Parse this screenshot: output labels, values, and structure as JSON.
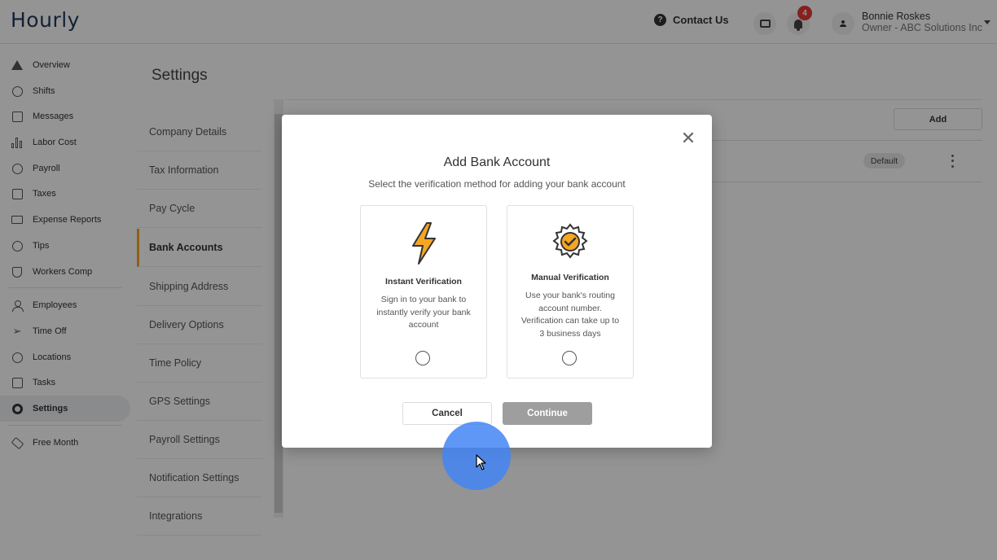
{
  "app": {
    "logo": "Hourly"
  },
  "header": {
    "contact_label": "Contact Us",
    "notification_count": "4",
    "user_name": "Bonnie Roskes",
    "user_role": "Owner - ABC Solutions Inc"
  },
  "sidebar": {
    "items": [
      {
        "label": "Overview",
        "icon": "home-icon"
      },
      {
        "label": "Shifts",
        "icon": "clock-icon"
      },
      {
        "label": "Messages",
        "icon": "messages-icon"
      },
      {
        "label": "Labor Cost",
        "icon": "bar-chart-icon"
      },
      {
        "label": "Payroll",
        "icon": "dollar-icon"
      },
      {
        "label": "Taxes",
        "icon": "document-icon"
      },
      {
        "label": "Expense Reports",
        "icon": "folder-icon"
      },
      {
        "label": "Tips",
        "icon": "coin-icon"
      },
      {
        "label": "Workers Comp",
        "icon": "shield-icon"
      },
      {
        "label": "Employees",
        "icon": "person-icon"
      },
      {
        "label": "Time Off",
        "icon": "plane-icon"
      },
      {
        "label": "Locations",
        "icon": "pin-icon"
      },
      {
        "label": "Tasks",
        "icon": "checklist-icon"
      },
      {
        "label": "Settings",
        "icon": "gear-icon"
      },
      {
        "label": "Free Month",
        "icon": "tag-icon"
      }
    ]
  },
  "settings": {
    "title": "Settings",
    "menu": [
      "Company Details",
      "Tax Information",
      "Pay Cycle",
      "Bank Accounts",
      "Shipping Address",
      "Delivery Options",
      "Time Policy",
      "GPS Settings",
      "Payroll Settings",
      "Notification Settings",
      "Integrations"
    ],
    "add_label": "Add",
    "default_badge": "Default"
  },
  "modal": {
    "title": "Add Bank Account",
    "subtitle": "Select the verification method for adding your bank account",
    "options": [
      {
        "title": "Instant Verification",
        "description": "Sign in to your bank to instantly verify your bank account",
        "icon": "lightning-icon"
      },
      {
        "title": "Manual Verification",
        "description": "Use your bank's routing account number. Verification can take up to 3 business days",
        "icon": "gear-check-icon"
      }
    ],
    "cancel_label": "Cancel",
    "continue_label": "Continue"
  },
  "colors": {
    "accent": "#f5a623",
    "continue_disabled": "#9e9e9e",
    "badge_red": "#e53935",
    "cursor_halo": "#4285f4"
  }
}
